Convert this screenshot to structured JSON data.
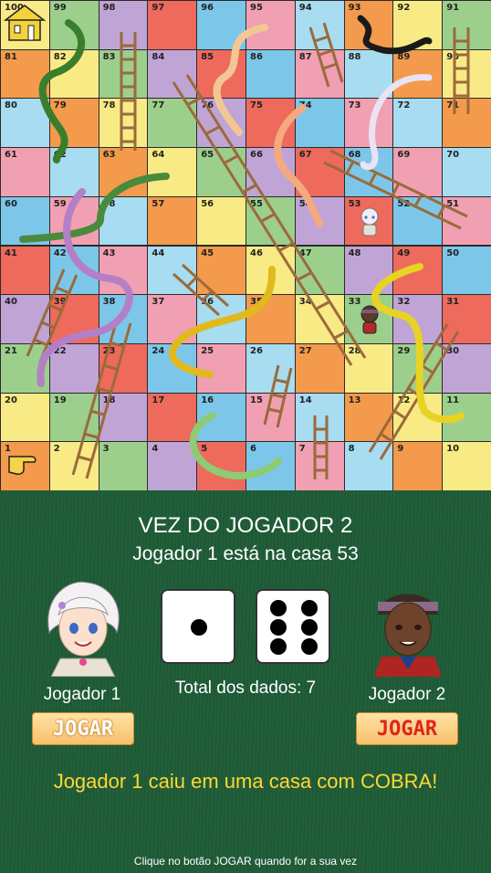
{
  "board": {
    "numbers": [
      [
        100,
        99,
        98,
        97,
        96,
        95,
        94,
        93,
        92,
        91
      ],
      [
        81,
        82,
        83,
        84,
        85,
        86,
        87,
        88,
        89,
        90
      ],
      [
        80,
        79,
        78,
        77,
        76,
        75,
        74,
        73,
        72,
        71
      ],
      [
        61,
        62,
        63,
        64,
        65,
        66,
        67,
        68,
        69,
        70
      ],
      [
        60,
        59,
        58,
        57,
        56,
        55,
        54,
        53,
        52,
        51
      ],
      [
        41,
        42,
        43,
        44,
        45,
        46,
        47,
        48,
        49,
        50
      ],
      [
        40,
        39,
        38,
        37,
        36,
        35,
        34,
        33,
        32,
        31
      ],
      [
        21,
        22,
        23,
        24,
        25,
        26,
        27,
        28,
        29,
        30
      ],
      [
        20,
        19,
        18,
        17,
        16,
        15,
        14,
        13,
        12,
        11
      ],
      [
        1,
        2,
        3,
        4,
        5,
        6,
        7,
        8,
        9,
        10
      ]
    ],
    "colors": {
      "yellow": "#f8eb86",
      "pink": "#f0a0b2",
      "purple": "#c0a4d6",
      "orange": "#f39a4c",
      "blue": "#7cc7e9",
      "green": "#9ccf8c",
      "lightblue": "#a7dcf1",
      "red": "#ee6a5c"
    },
    "house_icon": "house-icon",
    "start_icon": "pointing-hand-icon",
    "snake_color": "#3a7d2c",
    "ladder_color": "#9b6a3c"
  },
  "game": {
    "turn_text": "VEZ DO JOGADOR 2",
    "status_text": "Jogador 1 está na casa 53",
    "dice": [
      1,
      6
    ],
    "total_text": "Total dos dados: 7",
    "message": "Jogador 1 caiu em uma casa com COBRA!",
    "hint": "Clique no botão JOGAR quando for a sua vez",
    "message_color": "#ffd733"
  },
  "players": [
    {
      "name": "Jogador 1",
      "button": "JOGAR",
      "square": 53
    },
    {
      "name": "Jogador 2",
      "button": "JOGAR",
      "square": 33
    }
  ]
}
